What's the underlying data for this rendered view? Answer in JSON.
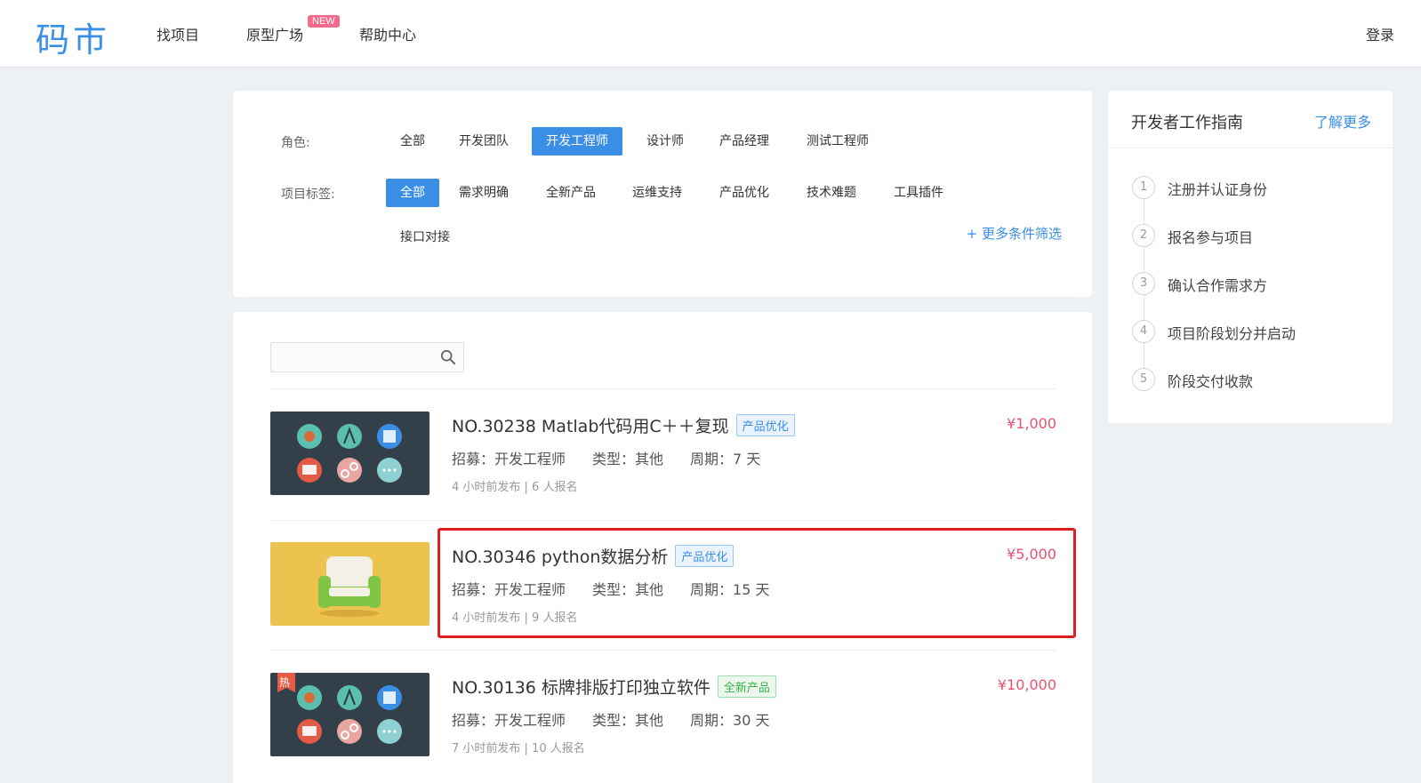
{
  "header": {
    "logo": "码市",
    "nav": [
      {
        "label": "找项目"
      },
      {
        "label": "原型广场",
        "badge": "NEW"
      },
      {
        "label": "帮助中心"
      }
    ],
    "login": "登录"
  },
  "filters": {
    "role_label": "角色:",
    "roles": [
      "全部",
      "开发团队",
      "开发工程师",
      "设计师",
      "产品经理",
      "测试工程师"
    ],
    "role_selected": "开发工程师",
    "tag_label": "项目标签:",
    "tags": [
      "全部",
      "需求明确",
      "全新产品",
      "运维支持",
      "产品优化",
      "技术难题",
      "工具插件",
      "接口对接"
    ],
    "tag_selected": "全部",
    "more": "+ 更多条件筛选"
  },
  "search": {
    "placeholder": ""
  },
  "projects": [
    {
      "title": "NO.30238  Matlab代码用C＋＋复现",
      "tag": "产品优化",
      "price": "¥1,000",
      "recruit": "招募：开发工程师",
      "type": "类型：其他",
      "period": "周期：7 天",
      "sub": "4 小时前发布  |  6 人报名",
      "thumb": "dark"
    },
    {
      "title": "NO.30346  python数据分析",
      "tag": "产品优化",
      "price": "¥5,000",
      "recruit": "招募：开发工程师",
      "type": "类型：其他",
      "period": "周期：15 天",
      "sub": "4 小时前发布  |  9 人报名",
      "thumb": "yellow"
    },
    {
      "title": "NO.30136  标牌排版打印独立软件",
      "tag": "全新产品",
      "hot": "热",
      "price": "¥10,000",
      "recruit": "招募：开发工程师",
      "type": "类型：其他",
      "period": "周期：30 天",
      "sub": "7 小时前发布  |  10 人报名",
      "thumb": "dark"
    }
  ],
  "guide": {
    "title": "开发者工作指南",
    "more": "了解更多",
    "steps": [
      {
        "num": "1",
        "label": "注册并认证身份"
      },
      {
        "num": "2",
        "label": "报名参与项目"
      },
      {
        "num": "3",
        "label": "确认合作需求方"
      },
      {
        "num": "4",
        "label": "项目阶段划分并启动"
      },
      {
        "num": "5",
        "label": "阶段交付收款"
      }
    ]
  },
  "colors": {
    "accent": "#3a8ee6",
    "price": "#e95270",
    "highlight": "#e02020"
  }
}
